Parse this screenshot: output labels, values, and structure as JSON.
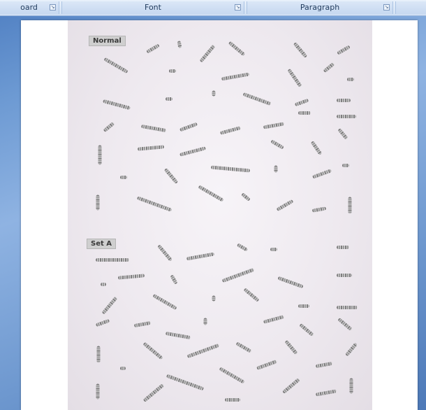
{
  "ribbon": {
    "groups": [
      {
        "label": "oard"
      },
      {
        "label": "Font"
      },
      {
        "label": "Paragraph"
      }
    ],
    "launcher_glyph": "↘"
  },
  "document": {
    "sections": [
      {
        "label": "Normal"
      },
      {
        "label": "Set A"
      }
    ]
  }
}
